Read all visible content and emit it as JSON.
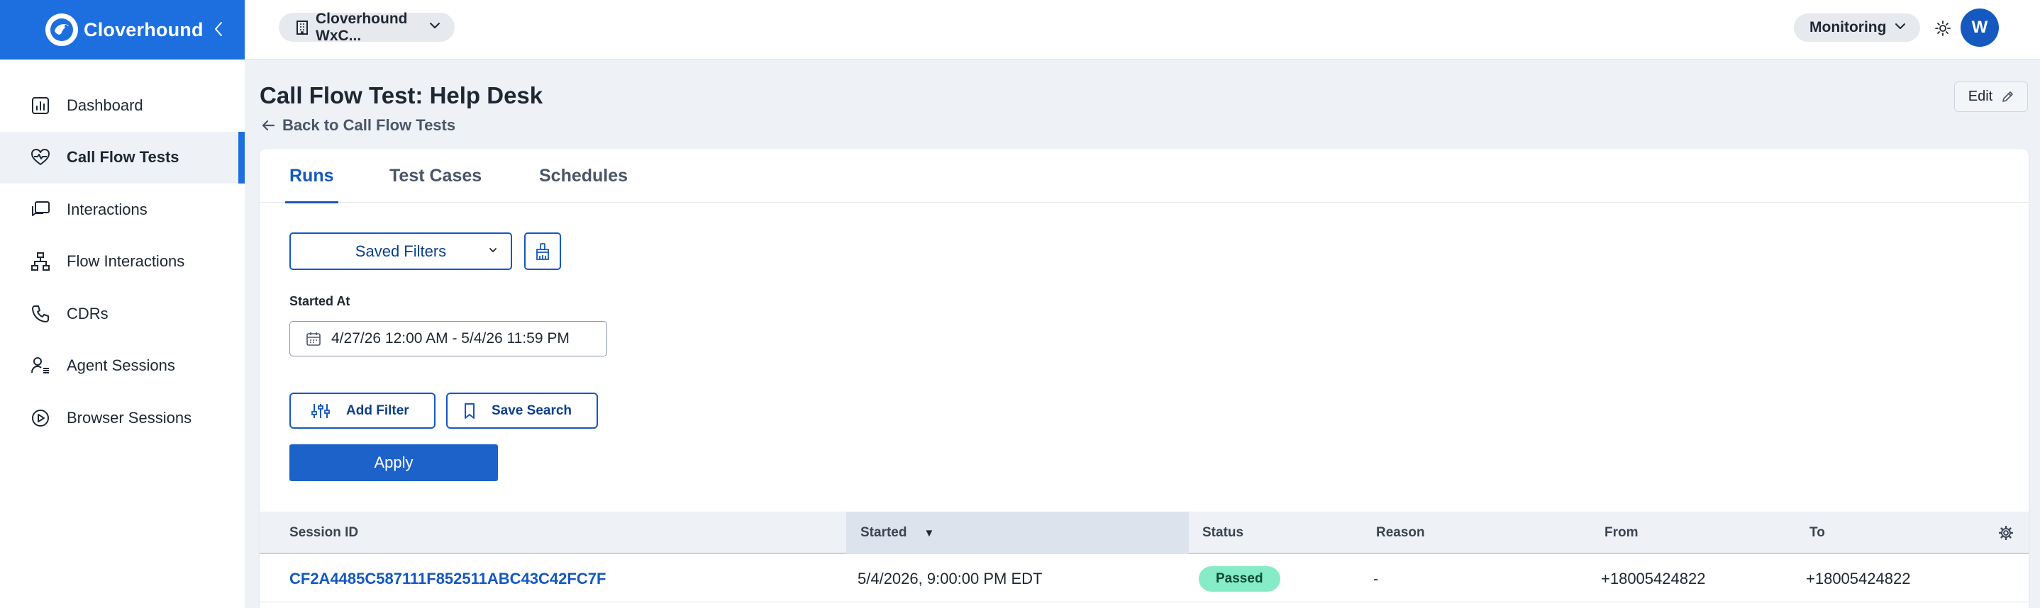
{
  "brand": {
    "name": "Cloverhound",
    "logo_icon": "cloverhound-logo-icon",
    "collapse_icon": "chevron-left-icon"
  },
  "sidebar": {
    "items": [
      {
        "label": "Dashboard",
        "icon": "bar-chart-icon",
        "active": false
      },
      {
        "label": "Call Flow Tests",
        "icon": "heart-pulse-icon",
        "active": true
      },
      {
        "label": "Interactions",
        "icon": "chat-bubbles-icon",
        "active": false
      },
      {
        "label": "Flow Interactions",
        "icon": "sitemap-icon",
        "active": false
      },
      {
        "label": "CDRs",
        "icon": "phone-icon",
        "active": false
      },
      {
        "label": "Agent Sessions",
        "icon": "user-list-icon",
        "active": false
      },
      {
        "label": "Browser Sessions",
        "icon": "play-circle-icon",
        "active": false
      }
    ]
  },
  "topbar": {
    "org_label": "Cloverhound WxC...",
    "mode_label": "Monitoring",
    "avatar_initial": "W"
  },
  "header": {
    "title": "Call Flow Test: Help Desk",
    "back_label": "Back to Call Flow Tests",
    "edit_label": "Edit"
  },
  "tabs": [
    {
      "label": "Runs",
      "active": true
    },
    {
      "label": "Test Cases",
      "active": false
    },
    {
      "label": "Schedules",
      "active": false
    }
  ],
  "filters": {
    "saved_filters_label": "Saved Filters",
    "started_at_label": "Started At",
    "date_range_value": "4/27/26 12:00 AM - 5/4/26 11:59 PM",
    "add_filter_label": "Add Filter",
    "save_search_label": "Save Search",
    "apply_label": "Apply"
  },
  "table": {
    "columns": [
      "Session ID",
      "Started",
      "Status",
      "Reason",
      "From",
      "To"
    ],
    "sort_indicator": "▼",
    "rows": [
      {
        "session_id": "CF2A4485C587111F852511ABC43C42FC7F",
        "started": "5/4/2026, 9:00:00 PM EDT",
        "status": "Passed",
        "reason": "-",
        "from": "+18005424822",
        "to": "+18005424822"
      }
    ]
  },
  "colors": {
    "accent": "#1d6fe0",
    "primary_button": "#1d62c9",
    "link": "#1558c0",
    "badge_passed": "#86ecc7"
  }
}
